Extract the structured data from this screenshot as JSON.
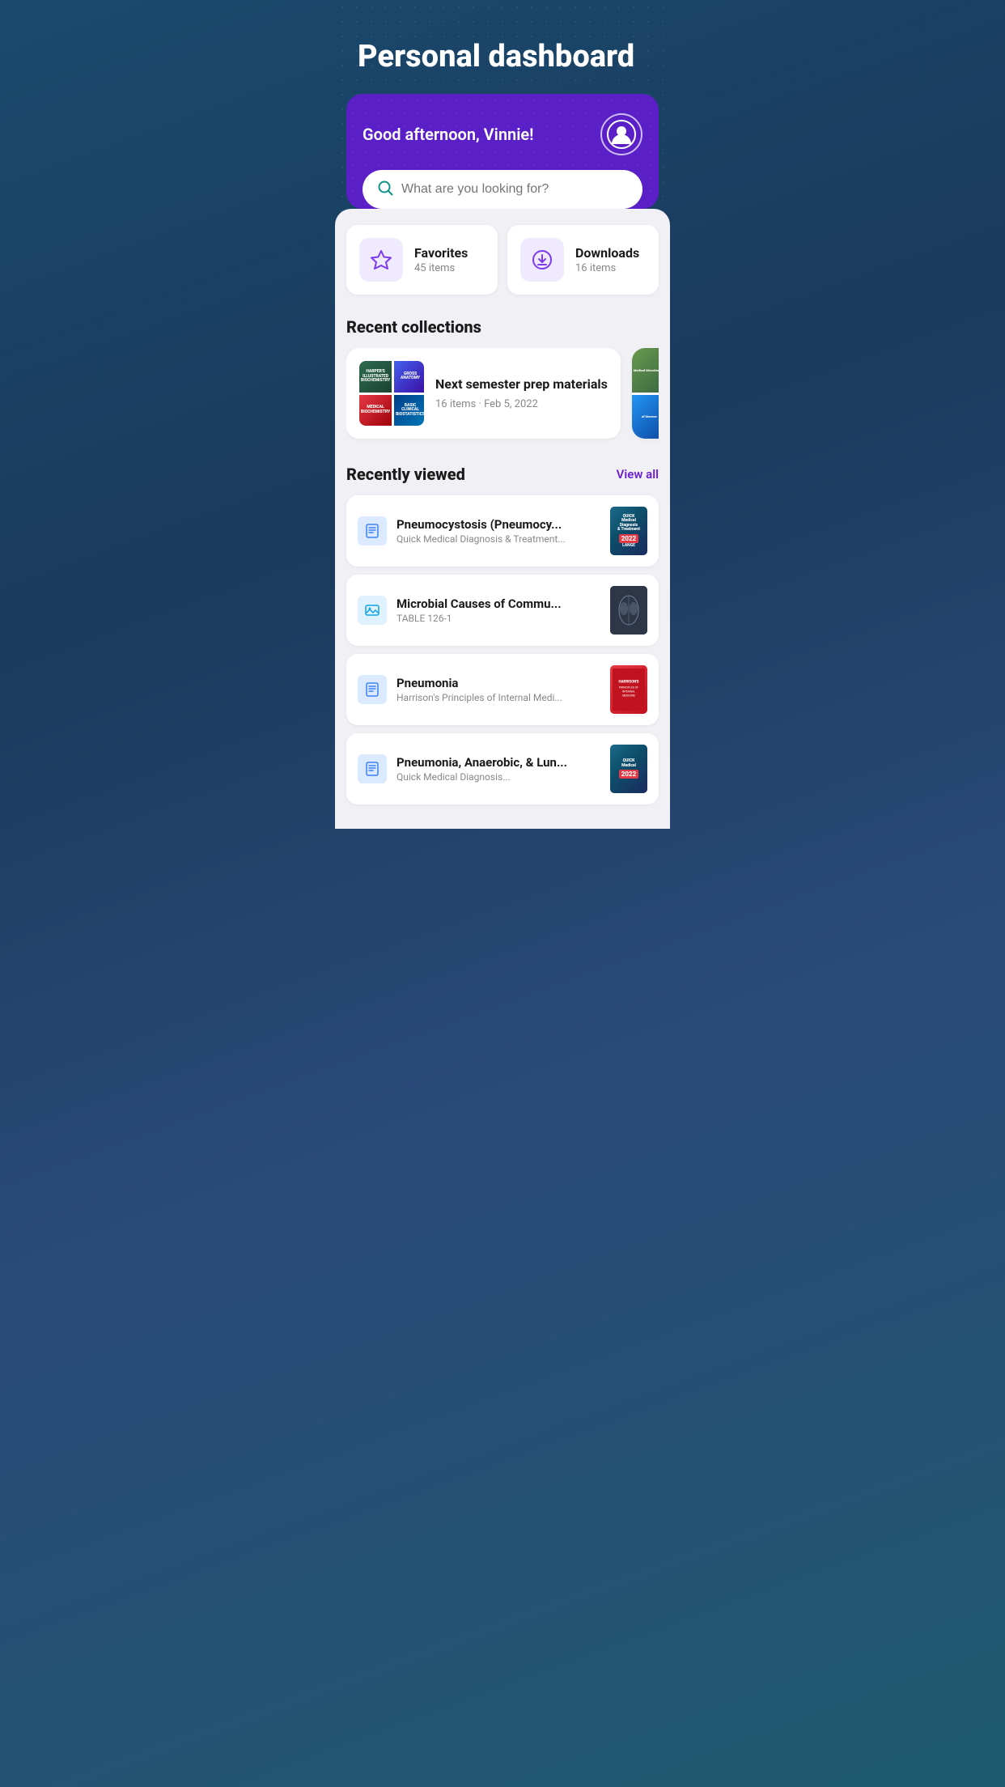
{
  "page": {
    "title": "Personal dashboard"
  },
  "header": {
    "greeting": "Good afternoon, Vinnie!",
    "search_placeholder": "What are you looking for?"
  },
  "quick_access": [
    {
      "id": "favorites",
      "label": "Favorites",
      "count": "45 items",
      "icon": "star-icon"
    },
    {
      "id": "downloads",
      "label": "Downloads",
      "count": "16 items",
      "icon": "download-icon"
    }
  ],
  "recent_collections": {
    "section_title": "Recent collections",
    "items": [
      {
        "title": "Next semester prep materials",
        "meta": "16 items · Feb 5, 2022"
      }
    ]
  },
  "recently_viewed": {
    "section_title": "Recently viewed",
    "view_all_label": "View all",
    "items": [
      {
        "title": "Pneumocystosis (Pneumocy...",
        "subtitle": "Quick Medical Diagnosis & Treatment...",
        "type": "chapter",
        "thumb_type": "quick"
      },
      {
        "title": "Microbial Causes of Commu...",
        "subtitle": "TABLE 126-1",
        "type": "image",
        "thumb_type": "xray"
      },
      {
        "title": "Pneumonia",
        "subtitle": "Harrison's Principles of Internal Medi...",
        "type": "chapter",
        "thumb_type": "harrison"
      },
      {
        "title": "Pneumonia, Anaerobic, & Lun...",
        "subtitle": "Quick Medical Diagnosis...",
        "type": "chapter",
        "thumb_type": "quick2"
      }
    ]
  },
  "colors": {
    "accent_purple": "#6b1fd1",
    "background_purple": "#5b1fc8",
    "teal": "#0d9488",
    "light_purple_bg": "#f0eaff"
  }
}
